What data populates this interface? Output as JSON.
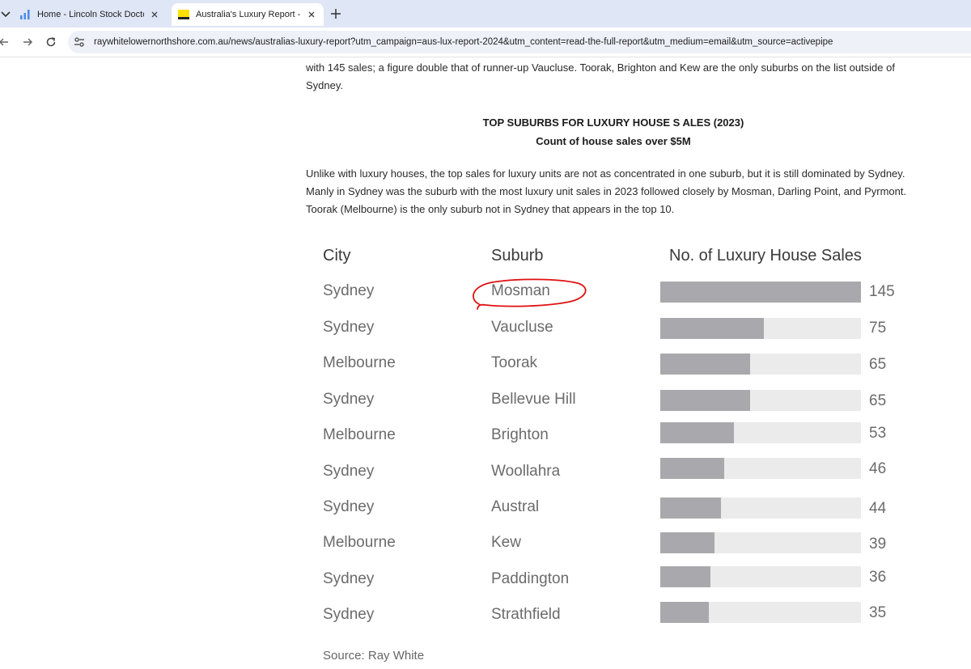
{
  "browser": {
    "tabs": [
      {
        "title": "Home - Lincoln Stock Doctor",
        "active": false
      },
      {
        "title": "Australia's Luxury Report - New",
        "active": true
      }
    ],
    "url": "raywhitelowernorthshore.com.au/news/australias-luxury-report?utm_campaign=aus-lux-report-2024&utm_content=read-the-full-report&utm_medium=email&utm_source=activepipe"
  },
  "article": {
    "p1_line1": "with 145 sales; a figure double that of runner-up Vaucluse. Toorak, Brighton and Kew are the only suburbs on the list outside of",
    "p1_line2": "Sydney.",
    "heading": "TOP SUBURBS FOR LUXURY HOUSE S ALES (2023)",
    "subheading": "Count of house sales over $5M",
    "p2_line1": "Unlike with luxury houses, the top sales for luxury units are not as concentrated in one suburb, but it is still dominated by Sydney.",
    "p2_line2": "Manly in Sydney was the suburb with the most luxury unit sales in 2023 followed closely by Mosman, Darling Point, and Pyrmont.",
    "p2_line3": "Toorak (Melbourne) is the only suburb not in Sydney that appears in the top 10."
  },
  "table": {
    "headers": {
      "city": "City",
      "suburb": "Suburb",
      "sales": "No. of Luxury House Sales"
    },
    "rows": [
      {
        "city": "Sydney",
        "suburb": "Mosman",
        "sales": "145"
      },
      {
        "city": "Sydney",
        "suburb": "Vaucluse",
        "sales": "75"
      },
      {
        "city": "Melbourne",
        "suburb": "Toorak",
        "sales": "65"
      },
      {
        "city": "Sydney",
        "suburb": "Bellevue Hill",
        "sales": "65"
      },
      {
        "city": "Melbourne",
        "suburb": "Brighton",
        "sales": "53"
      },
      {
        "city": "Sydney",
        "suburb": "Woollahra",
        "sales": "46"
      },
      {
        "city": "Sydney",
        "suburb": "Austral",
        "sales": "44"
      },
      {
        "city": "Melbourne",
        "suburb": "Kew",
        "sales": "39"
      },
      {
        "city": "Sydney",
        "suburb": "Paddington",
        "sales": "36"
      },
      {
        "city": "Sydney",
        "suburb": "Strathfield",
        "sales": "35"
      }
    ],
    "source": "Source: Ray White"
  },
  "chart_data": {
    "type": "bar",
    "categories": [
      "Mosman",
      "Vaucluse",
      "Toorak",
      "Bellevue Hill",
      "Brighton",
      "Woollahra",
      "Austral",
      "Kew",
      "Paddington",
      "Strathfield"
    ],
    "values": [
      145,
      75,
      65,
      65,
      53,
      46,
      44,
      39,
      36,
      35
    ],
    "ylim": [
      0,
      145
    ],
    "orientation": "horizontal",
    "grid": false,
    "colors": {
      "fill": "#a9a9ad",
      "track": "#ebebeb"
    }
  },
  "theme": {
    "tabbar_bg": "#dfe6f5",
    "annotation_color": "#e01010"
  }
}
